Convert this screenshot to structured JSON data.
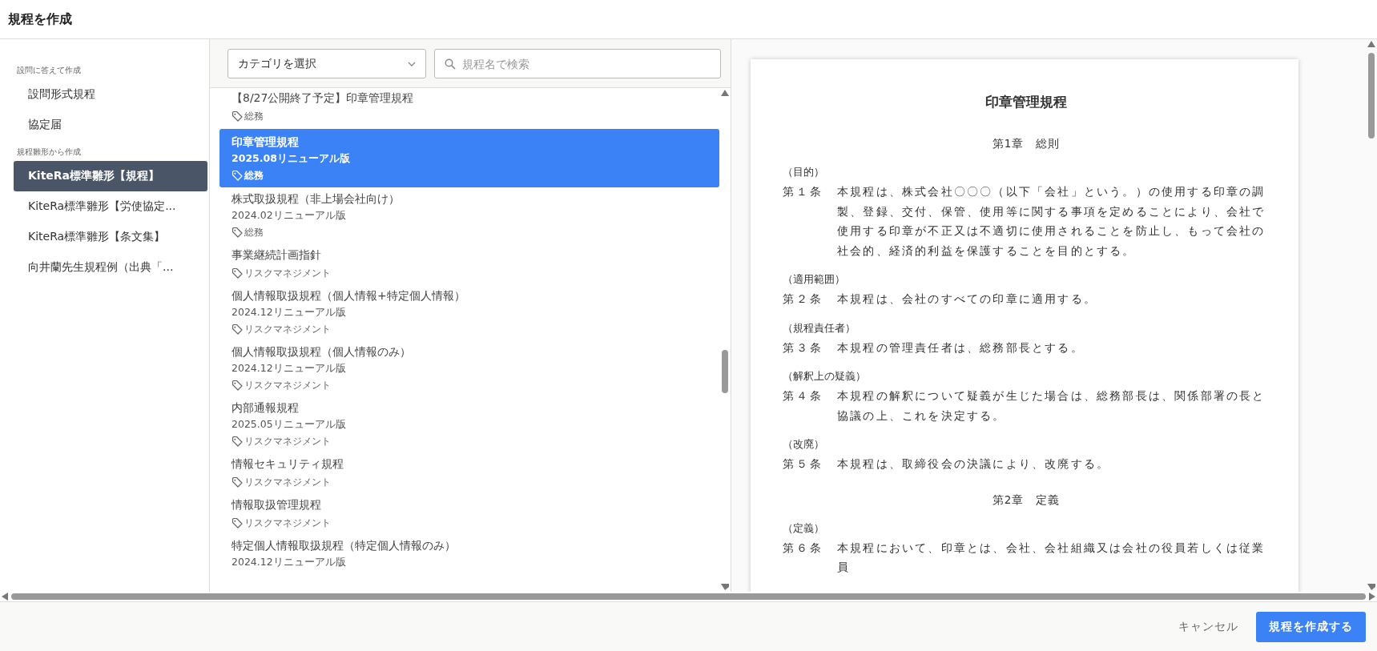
{
  "window": {
    "title": "規程を作成"
  },
  "sidebar": {
    "groups": [
      {
        "label": "設問に答えて作成",
        "items": [
          {
            "label": "設問形式規程",
            "selected": false
          },
          {
            "label": "協定届",
            "selected": false
          }
        ]
      },
      {
        "label": "規程雛形から作成",
        "items": [
          {
            "label": "KiteRa標準雛形【規程】",
            "selected": true
          },
          {
            "label": "KiteRa標準雛形【労使協定...",
            "selected": false
          },
          {
            "label": "KiteRa標準雛形【条文集】",
            "selected": false
          },
          {
            "label": "向井蘭先生規程例（出典「...",
            "selected": false
          }
        ]
      }
    ]
  },
  "filters": {
    "category": {
      "placeholder": "カテゴリを選択"
    },
    "search": {
      "placeholder": "規程名で検索"
    }
  },
  "templates": [
    {
      "name": "【8/27公開終了予定】印章管理規程",
      "tag": "総務",
      "selected": false
    },
    {
      "name": "印章管理規程",
      "version": "2025.08リニューアル版",
      "tag": "総務",
      "selected": true
    },
    {
      "name": "株式取扱規程（非上場会社向け）",
      "version": "2024.02リニューアル版",
      "tag": "総務",
      "selected": false
    },
    {
      "name": "事業継続計画指針",
      "tag": "リスクマネジメント",
      "selected": false
    },
    {
      "name": "個人情報取扱規程（個人情報+特定個人情報）",
      "version": "2024.12リニューアル版",
      "tag": "リスクマネジメント",
      "selected": false
    },
    {
      "name": "個人情報取扱規程（個人情報のみ）",
      "version": "2024.12リニューアル版",
      "tag": "リスクマネジメント",
      "selected": false
    },
    {
      "name": "内部通報規程",
      "version": "2025.05リニューアル版",
      "tag": "リスクマネジメント",
      "selected": false
    },
    {
      "name": "情報セキュリティ規程",
      "tag": "リスクマネジメント",
      "selected": false
    },
    {
      "name": "情報取扱管理規程",
      "tag": "リスクマネジメント",
      "selected": false
    },
    {
      "name": "特定個人情報取扱規程（特定個人情報のみ）",
      "version": "2024.12リニューアル版",
      "selected": false
    }
  ],
  "document": {
    "title": "印章管理規程",
    "sections": [
      {
        "kind": "chapter",
        "text": "第1章　総則"
      },
      {
        "kind": "article",
        "heading": "（目的）",
        "number": "第１条",
        "body": "本規程は、株式会社〇〇〇（以下「会社」という。）の使用する印章の調製、登録、交付、保管、使用等に関する事項を定めることにより、会社で使用する印章が不正又は不適切に使用されることを防止し、もって会社の社会的、経済的利益を保護することを目的とする。"
      },
      {
        "kind": "article",
        "heading": "（適用範囲）",
        "number": "第２条",
        "body": "本規程は、会社のすべての印章に適用する。"
      },
      {
        "kind": "article",
        "heading": "（規程責任者）",
        "number": "第３条",
        "body": "本規程の管理責任者は、総務部長とする。"
      },
      {
        "kind": "article",
        "heading": "（解釈上の疑義）",
        "number": "第４条",
        "body": "本規程の解釈について疑義が生じた場合は、総務部長は、関係部署の長と協議の上、これを決定する。"
      },
      {
        "kind": "article",
        "heading": "（改廃）",
        "number": "第５条",
        "body": "本規程は、取締役会の決議により、改廃する。"
      },
      {
        "kind": "chapter",
        "text": "第2章　定義"
      },
      {
        "kind": "article",
        "heading": "（定義）",
        "number": "第６条",
        "body": "本規程において、印章とは、会社、会社組織又は会社の役員若しくは従業員"
      }
    ]
  },
  "footer": {
    "buttons": [
      {
        "label": "キャンセル",
        "kind": "text"
      },
      {
        "label": "規程を作成する",
        "kind": "primary"
      }
    ]
  }
}
